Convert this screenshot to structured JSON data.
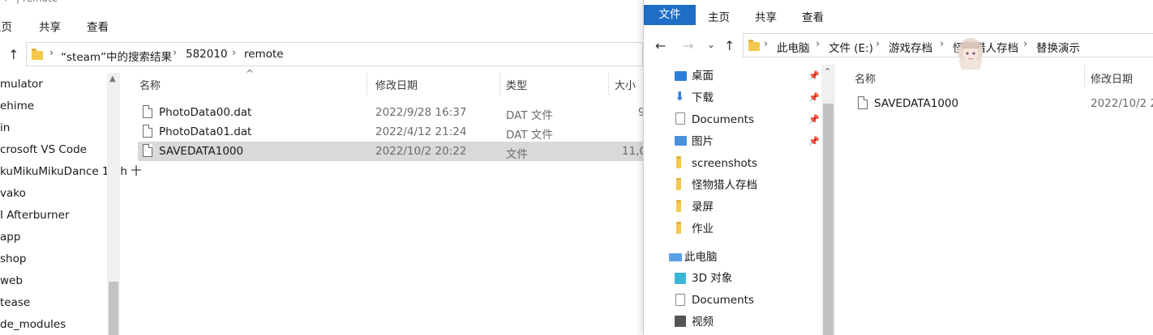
{
  "left_window": {
    "title": "remote",
    "ribbon_tabs": [
      "主页",
      "共享",
      "查看"
    ],
    "address": [
      "“steam”中的搜索结果",
      "582010",
      "remote"
    ],
    "nav_items": [
      "mulator",
      "ehime",
      "in",
      "crosoft VS Code",
      "kuMikuMikuDance 10th 十",
      "vako",
      "I Afterburner",
      "app",
      "shop",
      "web",
      "tease",
      "de_modules"
    ],
    "columns": {
      "name": "名称",
      "modified": "修改日期",
      "type": "类型",
      "size": "大小"
    },
    "files": [
      {
        "name": "PhotoData00.dat",
        "modified": "2022/9/28 16:37",
        "type": "DAT 文件",
        "size": "9"
      },
      {
        "name": "PhotoData01.dat",
        "modified": "2022/4/12 21:24",
        "type": "DAT 文件",
        "size": ""
      },
      {
        "name": "SAVEDATA1000",
        "modified": "2022/10/2 20:22",
        "type": "文件",
        "size": "11,0"
      }
    ]
  },
  "right_window": {
    "ribbon_tabs": {
      "file": "文件",
      "home": "主页",
      "share": "共享",
      "view": "查看"
    },
    "address": [
      "此电脑",
      "文件 (E:)",
      "游戏存档",
      "怪物猎人存档",
      "替换演示"
    ],
    "quick_access": [
      {
        "label": "桌面",
        "icon": "desktop-icon",
        "color": "#2f7fd8",
        "pinned": true
      },
      {
        "label": "下载",
        "icon": "download-icon",
        "color": "#2f7fd8",
        "pinned": true
      },
      {
        "label": "Documents",
        "icon": "document-icon",
        "color": "#8a8a8a",
        "pinned": true
      },
      {
        "label": "图片",
        "icon": "pictures-icon",
        "color": "#4a90d9",
        "pinned": true
      },
      {
        "label": "screenshots",
        "icon": "folder-icon",
        "color": "#f2c94c",
        "pinned": false
      },
      {
        "label": "怪物猎人存档",
        "icon": "folder-icon",
        "color": "#f2c94c",
        "pinned": false
      },
      {
        "label": "录屏",
        "icon": "folder-icon",
        "color": "#f2c94c",
        "pinned": false
      },
      {
        "label": "作业",
        "icon": "folder-icon",
        "color": "#f2c94c",
        "pinned": false
      }
    ],
    "this_pc": "此电脑",
    "pc_items": [
      {
        "label": "3D 对象",
        "icon": "3d-objects-icon",
        "color": "#3bb6d6"
      },
      {
        "label": "Documents",
        "icon": "document-icon",
        "color": "#8a8a8a"
      },
      {
        "label": "视频",
        "icon": "video-icon",
        "color": "#555555"
      }
    ],
    "columns": {
      "name": "名称",
      "modified": "修改日期"
    },
    "files": [
      {
        "name": "SAVEDATA1000",
        "modified": "2022/10/2 2"
      }
    ]
  },
  "colors": {
    "accent": "#1e6ec8",
    "selection": "#d9d9d9",
    "folder": "#f2c94c"
  }
}
